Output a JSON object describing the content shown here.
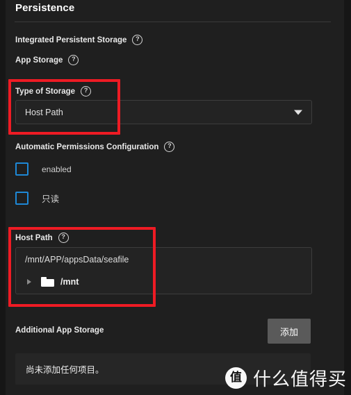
{
  "panel": {
    "title": "Persistence"
  },
  "sections": {
    "integrated_persistent_storage": {
      "label": "Integrated Persistent Storage",
      "help_icon": "help-circle-icon"
    },
    "app_storage": {
      "label": "App Storage",
      "help_icon": "help-circle-icon"
    },
    "type_of_storage": {
      "label": "Type of Storage",
      "help_icon": "help-circle-icon",
      "selected_value": "Host Path",
      "caret_icon": "chevron-down-icon"
    },
    "automatic_permissions": {
      "label": "Automatic Permissions Configuration",
      "help_icon": "help-circle-icon",
      "checkboxes": [
        {
          "label": "enabled",
          "checked": false
        },
        {
          "label": "只读",
          "checked": false
        }
      ]
    },
    "host_path": {
      "label": "Host Path",
      "help_icon": "help-circle-icon",
      "input_value": "/mnt/APP/appsData/seafile",
      "tree": {
        "caret_icon": "triangle-right-icon",
        "folder_icon": "folder-icon",
        "label": "/mnt"
      }
    },
    "additional_app_storage": {
      "label": "Additional App Storage",
      "add_button_label": "添加",
      "empty_text": "尚未添加任何项目。"
    }
  },
  "annotations": {
    "highlight_color": "#ee1b24",
    "boxes": [
      {
        "name": "type-of-storage-highlight"
      },
      {
        "name": "host-path-highlight"
      }
    ]
  },
  "watermark": {
    "logo_char": "值",
    "text": "什么值得买"
  },
  "colors": {
    "background": "#1f1f1f",
    "field_background": "#232323",
    "field_border": "#3d3d3d",
    "checkbox_accent": "#1e88d6",
    "button_background": "#5a5a5a",
    "highlight": "#ee1b24"
  }
}
